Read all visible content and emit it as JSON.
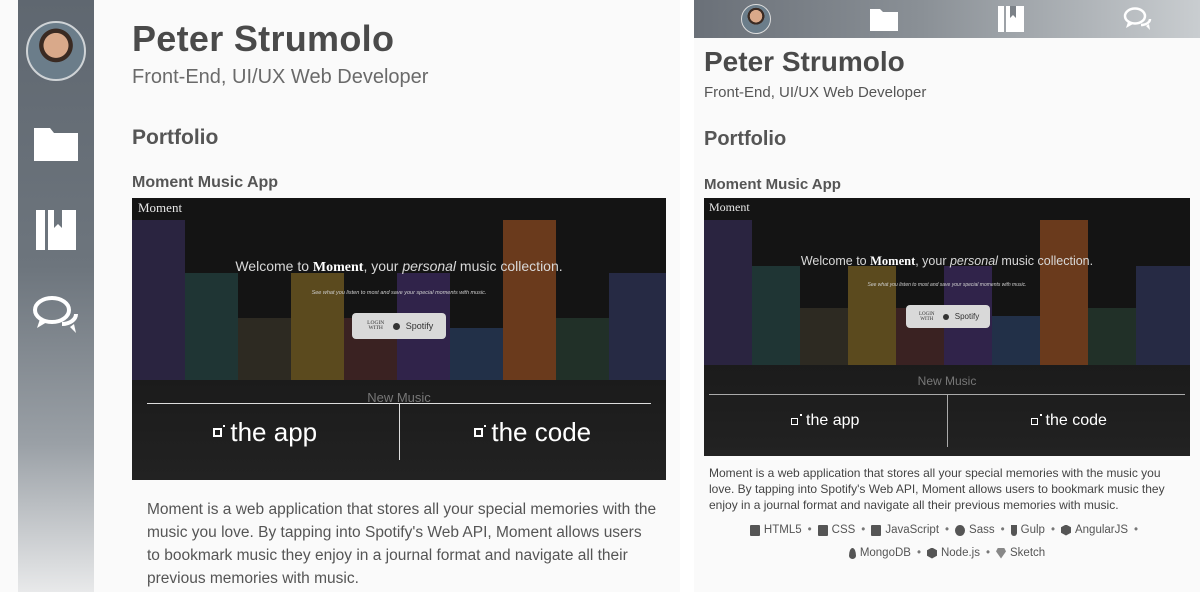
{
  "profile": {
    "name": "Peter Strumolo",
    "role": "Front-End, UI/UX Web Developer"
  },
  "section": {
    "title": "Portfolio"
  },
  "project": {
    "title": "Moment Music App",
    "app_name": "Moment",
    "welcome_prefix": "Welcome to ",
    "welcome_brand": "Moment",
    "welcome_mid": ", your ",
    "welcome_em": "personal",
    "welcome_suffix": " music collection.",
    "subtitle": "See what you listen to most and save your special moments with music.",
    "login_with": "LOGIN WITH",
    "login_service": "Spotify",
    "new_music": "New Music",
    "link_app": "the app",
    "link_code": "the code",
    "description": "Moment is a web application that stores all your special memories with the music you love. By tapping into Spotify's Web API, Moment allows users to bookmark music they enjoy in a journal format and navigate all their previous memories with music."
  },
  "nav": {
    "items": [
      {
        "name": "avatar",
        "icon": "profile-photo"
      },
      {
        "name": "portfolio",
        "icon": "folder-icon"
      },
      {
        "name": "resume",
        "icon": "book-icon"
      },
      {
        "name": "contact",
        "icon": "chat-bubbles-icon"
      }
    ]
  },
  "tech": {
    "row1": [
      "HTML5",
      "CSS",
      "JavaScript",
      "Sass",
      "Gulp",
      "AngularJS"
    ],
    "row2": [
      "MongoDB",
      "Node.js",
      "Sketch"
    ],
    "separator": "•"
  },
  "colors": {
    "sidebar_top": "#5f6770",
    "text_dark": "#4a4a4a",
    "screenshot_bg": "#141414"
  }
}
